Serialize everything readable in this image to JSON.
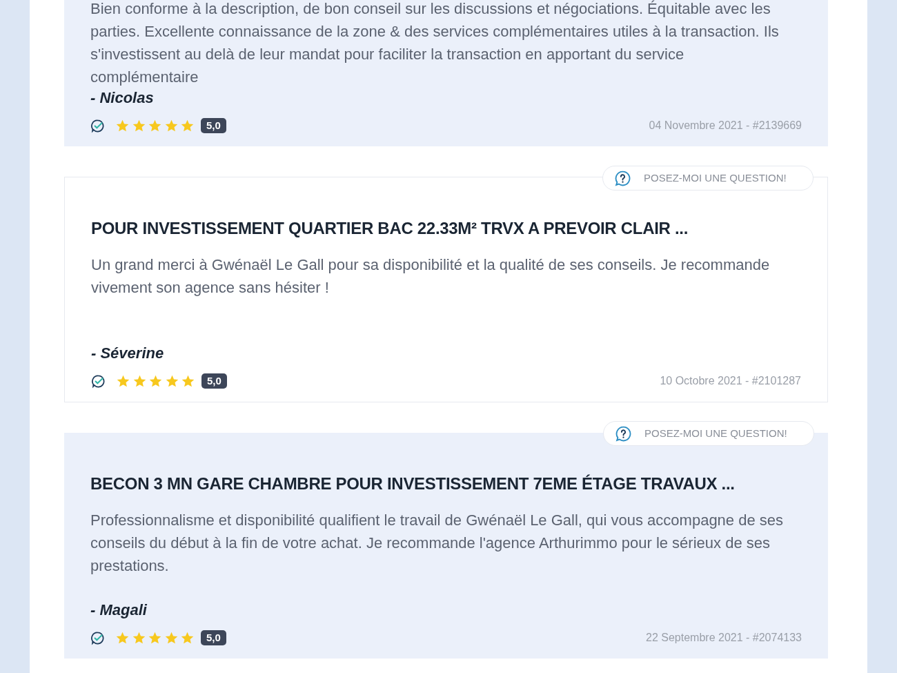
{
  "reviews": [
    {
      "kind": "tinted",
      "text": "Bien conforme à la description, de bon conseil sur les discussions et négociations. Équitable avec les parties. Excellente connaissance de la zone & des services complémentaires utiles à la transaction. Ils s'investissent au delà de leur mandat pour faciliter la transaction en apportant du service complémentaire",
      "author": "- Nicolas",
      "stars": 5,
      "score": "5,0",
      "date": "04 Novembre 2021 - #2139669"
    },
    {
      "kind": "plain",
      "ask_button": "POSEZ-MOI UNE QUESTION!",
      "title": "POUR INVESTISSEMENT QUARTIER BAC 22.33M² TRVX A PREVOIR CLAIR ...",
      "text": "Un grand merci à Gwénaël Le Gall pour sa disponibilité et la qualité de ses conseils. Je recommande vivement son agence sans hésiter !",
      "author": "- Séverine",
      "stars": 5,
      "score": "5,0",
      "date": "10 Octobre 2021 - #2101287"
    },
    {
      "kind": "tinted",
      "ask_button": "POSEZ-MOI UNE QUESTION!",
      "title": "BECON 3 MN GARE CHAMBRE POUR INVESTISSEMENT 7EME ÉTAGE TRAVAUX ...",
      "text": "Professionnalisme et disponibilité qualifient le travail de Gwénaël Le Gall, qui vous accompagne de ses conseils du début à la fin de votre achat. Je recommande l'agence Arthurimmo pour le sérieux de ses prestations.",
      "author": "- Magali",
      "stars": 5,
      "score": "5,0",
      "date": "22 Septembre 2021 - #2074133"
    }
  ]
}
